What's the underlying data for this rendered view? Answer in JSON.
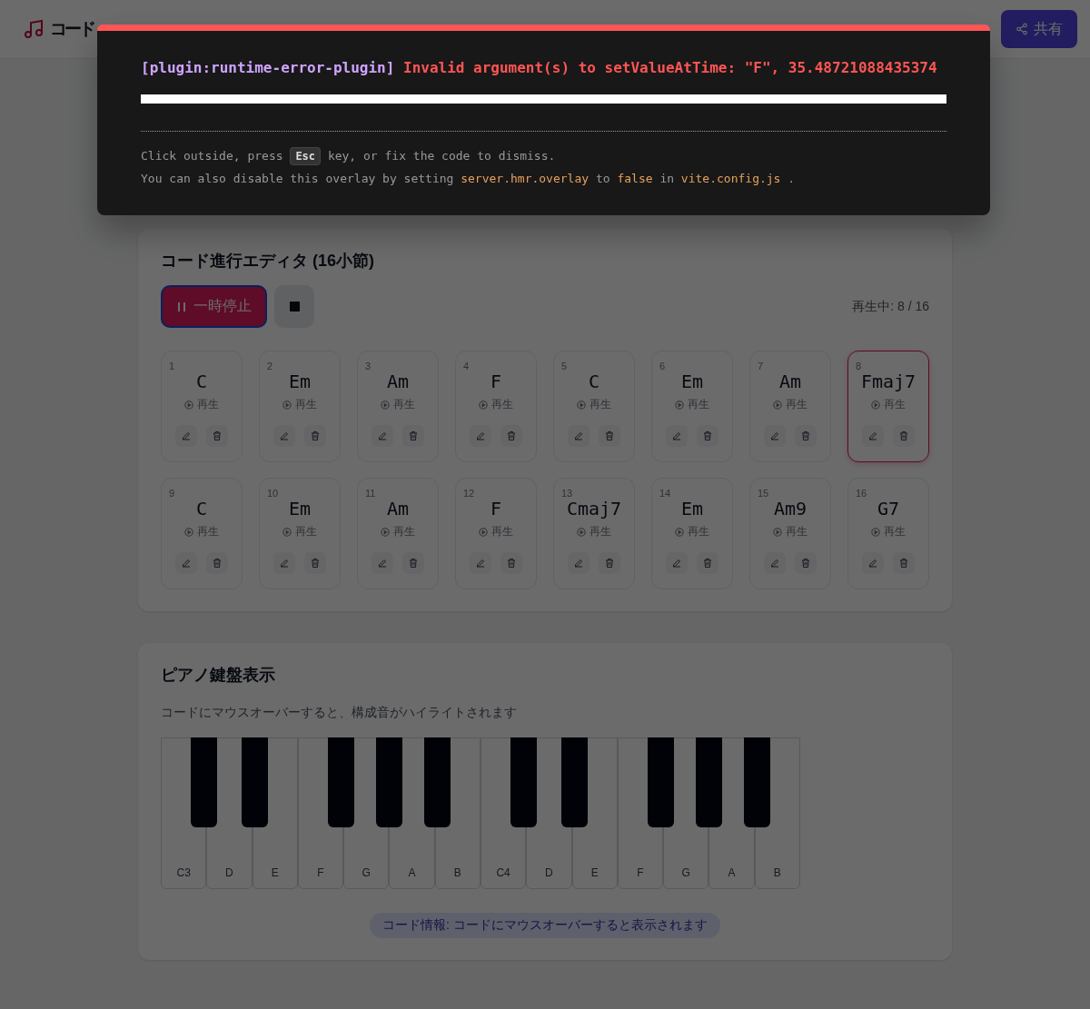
{
  "header": {
    "title": "コード",
    "share_button": "共有"
  },
  "error_overlay": {
    "plugin": "[plugin:runtime-error-plugin]",
    "message": "Invalid argument(s) to setValueAtTime: \"F\", 35.48721088435374",
    "tip_lines": [
      [
        {
          "kind": "text",
          "text": "Click outside, press"
        },
        {
          "kind": "kbd",
          "text": "Esc"
        },
        {
          "kind": "text",
          "text": "key, or fix the code to dismiss."
        }
      ],
      [
        {
          "kind": "text",
          "text": "You can also disable this overlay by setting"
        },
        {
          "kind": "code",
          "text": "server.hmr.overlay"
        },
        {
          "kind": "text",
          "text": "to"
        },
        {
          "kind": "code",
          "text": "false"
        },
        {
          "kind": "text",
          "text": "in"
        },
        {
          "kind": "code",
          "text": "vite.config.js"
        },
        {
          "kind": "text",
          "text": "."
        }
      ]
    ]
  },
  "editor": {
    "title": "コード進行エディタ (16小節)",
    "pause_button": "一時停止",
    "status": "再生中: 8 / 16",
    "bars": [
      {
        "number": "1",
        "chord": "C",
        "play": "再生",
        "selected": false
      },
      {
        "number": "2",
        "chord": "Em",
        "play": "再生",
        "selected": false
      },
      {
        "number": "3",
        "chord": "Am",
        "play": "再生",
        "selected": false
      },
      {
        "number": "4",
        "chord": "F",
        "play": "再生",
        "selected": false
      },
      {
        "number": "5",
        "chord": "C",
        "play": "再生",
        "selected": false
      },
      {
        "number": "6",
        "chord": "Em",
        "play": "再生",
        "selected": false
      },
      {
        "number": "7",
        "chord": "Am",
        "play": "再生",
        "selected": false
      },
      {
        "number": "8",
        "chord": "Fmaj7",
        "play": "再生",
        "selected": true
      },
      {
        "number": "9",
        "chord": "C",
        "play": "再生",
        "selected": false
      },
      {
        "number": "10",
        "chord": "Em",
        "play": "再生",
        "selected": false
      },
      {
        "number": "11",
        "chord": "Am",
        "play": "再生",
        "selected": false
      },
      {
        "number": "12",
        "chord": "F",
        "play": "再生",
        "selected": false
      },
      {
        "number": "13",
        "chord": "Cmaj7",
        "play": "再生",
        "selected": false
      },
      {
        "number": "14",
        "chord": "Em",
        "play": "再生",
        "selected": false
      },
      {
        "number": "15",
        "chord": "Am9",
        "play": "再生",
        "selected": false
      },
      {
        "number": "16",
        "chord": "G7",
        "play": "再生",
        "selected": false
      }
    ]
  },
  "piano": {
    "title": "ピアノ鍵盤表示",
    "hint": "コードにマウスオーバーすると、構成音がハイライトされます",
    "white_keys": [
      "C3",
      "D",
      "E",
      "F",
      "G",
      "A",
      "B",
      "C4",
      "D",
      "E",
      "F",
      "G",
      "A",
      "B"
    ],
    "chord_info": "コード情報: コードにマウスオーバーすると表示されます"
  }
}
